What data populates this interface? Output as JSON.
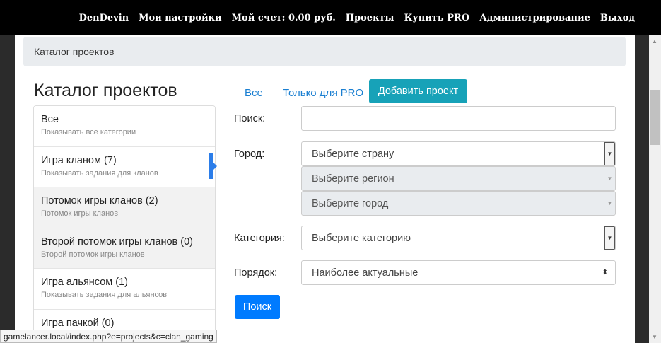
{
  "nav": {
    "items": [
      "DenDevin",
      "Мои настройки",
      "Мой счет: 0.00 руб.",
      "Проекты",
      "Купить PRO",
      "Администрирование",
      "Выход"
    ]
  },
  "breadcrumb": "Каталог проектов",
  "page_title": "Каталог проектов",
  "categories": [
    {
      "name": "Все",
      "desc": "Показывать все категории"
    },
    {
      "name": "Игра кланом (7)",
      "desc": "Показывать задания для кланов"
    },
    {
      "name": "Потомок игры кланов (2)",
      "desc": "Потомок игры кланов"
    },
    {
      "name": "Второй потомок игры кланов (0)",
      "desc": "Второй потомок игры кланов"
    },
    {
      "name": "Игра альянсом (1)",
      "desc": "Показывать задания для альянсов"
    },
    {
      "name": "Игра пачкой (0)",
      "desc": ""
    }
  ],
  "tabs": {
    "all": "Все",
    "pro": "Только для PRO"
  },
  "add_button": "Добавить проект",
  "form": {
    "search_label": "Поиск:",
    "search_value": "",
    "city_label": "Город:",
    "country_placeholder": "Выберите страну",
    "region_placeholder": "Выберите регион",
    "city_placeholder": "Выберите город",
    "category_label": "Категория:",
    "category_placeholder": "Выберите категорию",
    "order_label": "Порядок:",
    "order_value": "Наиболее актуальные",
    "submit_label": "Поиск"
  },
  "status_url": "gamelancer.local/index.php?e=projects&c=clan_gaming",
  "colors": {
    "accent_blue": "#007bff",
    "teal": "#17a2b8",
    "link": "#1a7fd1"
  }
}
